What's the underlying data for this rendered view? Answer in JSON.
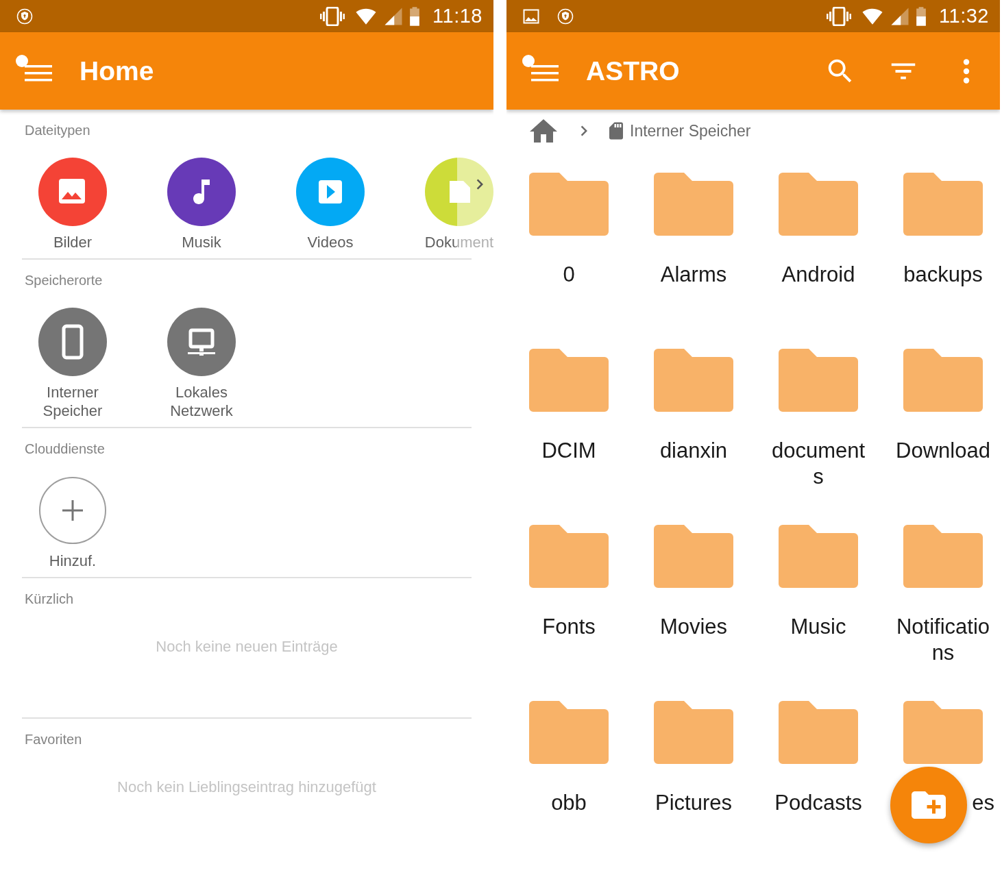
{
  "home_screen": {
    "status_bar": {
      "notifications": [
        {
          "kind": "shield"
        }
      ],
      "time": "11:18"
    },
    "app_bar": {
      "title": "Home"
    },
    "sections": [
      {
        "title": "Dateitypen",
        "kind": "tiles",
        "items": [
          {
            "label": "Bilder",
            "kind": "image",
            "color": "#f44336"
          },
          {
            "label": "Musik",
            "kind": "music",
            "color": "#673ab7"
          },
          {
            "label": "Videos",
            "kind": "video",
            "color": "#03a9f4"
          },
          {
            "label": "Dokument",
            "kind": "document",
            "color": "#cddc39"
          }
        ]
      },
      {
        "title": "Speicherorte",
        "kind": "tiles",
        "items": [
          {
            "label": "Interner Speicher",
            "kind": "phone",
            "color": "#757575"
          },
          {
            "label": "Lokales Netzwerk",
            "kind": "network",
            "color": "#757575"
          }
        ]
      },
      {
        "title": "Clouddienste",
        "kind": "tiles",
        "items": [
          {
            "label": "Hinzuf.",
            "kind": "add"
          }
        ]
      },
      {
        "title": "Kürzlich",
        "kind": "empty",
        "message": "Noch keine neuen Einträge"
      },
      {
        "title": "Favoriten",
        "kind": "empty",
        "message": "Noch kein Lieblingseintrag hinzugefügt"
      }
    ]
  },
  "astro_screen": {
    "status_bar": {
      "notifications": [
        {
          "kind": "image"
        },
        {
          "kind": "shield"
        }
      ],
      "time": "11:32"
    },
    "app_bar": {
      "title": "ASTRO",
      "actions": [
        {
          "kind": "search"
        },
        {
          "kind": "filter"
        },
        {
          "kind": "more"
        }
      ]
    },
    "breadcrumb": [
      {
        "label": "Interner Speicher"
      }
    ],
    "folders": [
      {
        "label": "0"
      },
      {
        "label": "Alarms"
      },
      {
        "label": "Android"
      },
      {
        "label": "backups"
      },
      {
        "label": "DCIM"
      },
      {
        "label": "dianxin"
      },
      {
        "label": "documents"
      },
      {
        "label": "Download"
      },
      {
        "label": "Fonts"
      },
      {
        "label": "Movies"
      },
      {
        "label": "Music"
      },
      {
        "label": "Notifications"
      },
      {
        "label": "obb"
      },
      {
        "label": "Pictures"
      },
      {
        "label": "Podcasts"
      },
      {
        "label": "es",
        "covered": true
      }
    ]
  }
}
